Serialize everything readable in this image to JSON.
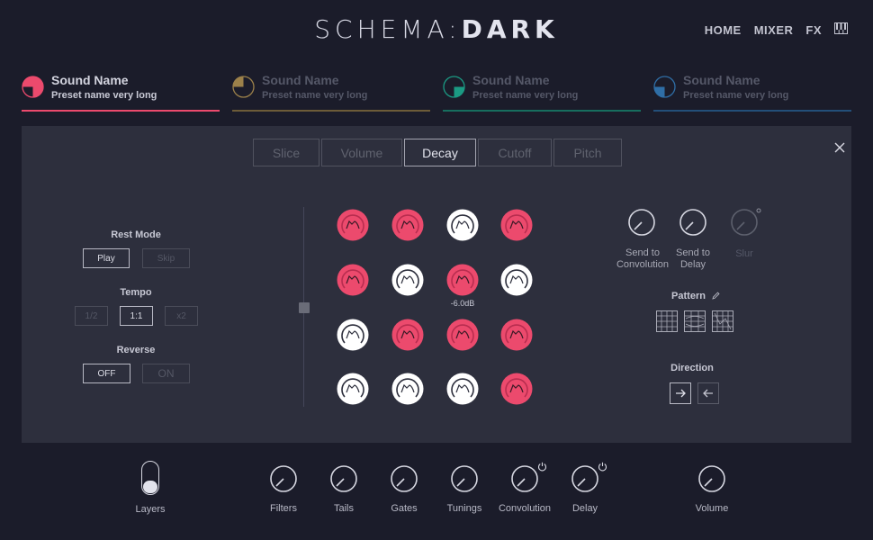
{
  "header": {
    "logo_left": "SCHEMA:",
    "logo_right": "DARK",
    "nav": {
      "home": "HOME",
      "mixer": "MIXER",
      "fx": "FX"
    },
    "keyboard_icon": "piano-icon"
  },
  "slots": [
    {
      "sound": "Sound Name",
      "preset": "Preset name very long",
      "color": "#ec4a6d"
    },
    {
      "sound": "Sound Name",
      "preset": "Preset name very long",
      "color": "#9c814a"
    },
    {
      "sound": "Sound Name",
      "preset": "Preset name very long",
      "color": "#1b9a83"
    },
    {
      "sound": "Sound Name",
      "preset": "Preset name very long",
      "color": "#2f6ea6"
    }
  ],
  "tabs": [
    "Slice",
    "Volume",
    "Decay",
    "Cutoff",
    "Pitch"
  ],
  "active_tab": "Decay",
  "rest_mode": {
    "label": "Rest Mode",
    "play": "Play",
    "skip": "Skip"
  },
  "tempo": {
    "label": "Tempo",
    "half": "1/2",
    "one": "1:1",
    "double": "x2"
  },
  "reverse": {
    "label": "Reverse",
    "off": "OFF",
    "on": "ON"
  },
  "pads": [
    [
      "pink",
      "pink",
      "white",
      "pink"
    ],
    [
      "pink",
      "white",
      "pink",
      "white"
    ],
    [
      "white",
      "pink",
      "pink",
      "pink"
    ],
    [
      "white",
      "white",
      "white",
      "pink"
    ]
  ],
  "pad_readout": "-6.0dB",
  "sends": {
    "convolution": "Send to\nConvolution",
    "delay": "Send to\nDelay",
    "slur": "Slur"
  },
  "pattern_label": "Pattern",
  "direction_label": "Direction",
  "bottom": {
    "layers": "Layers",
    "filters": "Filters",
    "tails": "Tails",
    "gates": "Gates",
    "tunings": "Tunings",
    "convolution": "Convolution",
    "delay": "Delay",
    "volume": "Volume"
  },
  "colors": {
    "accent": "#ec4a6d",
    "panel": "#2d2f3d",
    "background": "#1b1c2a"
  }
}
